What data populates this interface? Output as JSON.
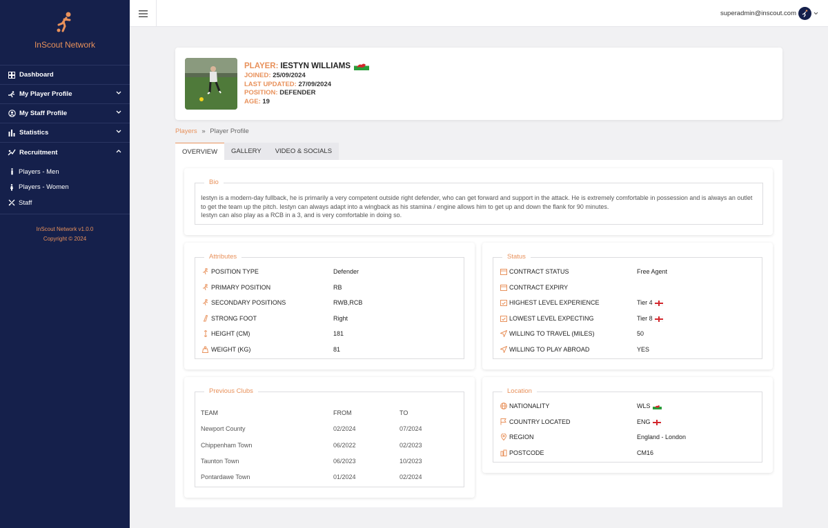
{
  "app": {
    "name": "InScout Network",
    "version": "InScout Network v1.0.0",
    "copyright": "Copyright © 2024"
  },
  "topbar": {
    "user_email": "superadmin@inscout.com"
  },
  "sidebar": {
    "items": [
      {
        "label": "Dashboard",
        "icon": "dashboard-icon"
      },
      {
        "label": "My Player Profile",
        "icon": "runner-icon"
      },
      {
        "label": "My Staff Profile",
        "icon": "user-circle-icon"
      },
      {
        "label": "Statistics",
        "icon": "bar-chart-icon"
      },
      {
        "label": "Recruitment",
        "icon": "recruitment-icon"
      }
    ],
    "sub_items": [
      {
        "label": "Players - Men"
      },
      {
        "label": "Players - Women"
      },
      {
        "label": "Staff"
      }
    ]
  },
  "player": {
    "player_label": "PLAYER:",
    "name": "IESTYN WILLIAMS",
    "joined_label": "JOINED:",
    "joined": "25/09/2024",
    "updated_label": "LAST UPDATED:",
    "updated": "27/09/2024",
    "position_label": "POSITION:",
    "position": "DEFENDER",
    "age_label": "AGE:",
    "age": "19"
  },
  "breadcrumb": {
    "link": "Players",
    "separator": "»",
    "current": "Player Profile"
  },
  "tabs": [
    "OVERVIEW",
    "GALLERY",
    "VIDEO & SOCIALS"
  ],
  "bio": {
    "title": "Bio",
    "text": "Iestyn is a modern-day fullback, he is primarily a very competent outside right defender, who can get forward and support in the attack. He is extremely comfortable in possession and is always an outlet to get the team up the pitch. Iestyn can always adapt into a wingback as his stamina / engine allows him to get up and down the flank for 90 minutes.",
    "text2": "Iestyn can also play as a RCB in a 3, and is very comfortable in doing so."
  },
  "attributes": {
    "title": "Attributes",
    "rows": [
      {
        "label": "POSITION TYPE",
        "value": "Defender"
      },
      {
        "label": "PRIMARY POSITION",
        "value": "RB"
      },
      {
        "label": "SECONDARY POSITIONS",
        "value": "RWB,RCB"
      },
      {
        "label": "STRONG FOOT",
        "value": "Right"
      },
      {
        "label": "HEIGHT (CM)",
        "value": "181"
      },
      {
        "label": "WEIGHT (KG)",
        "value": "81"
      }
    ]
  },
  "status": {
    "title": "Status",
    "rows": [
      {
        "label": "CONTRACT STATUS",
        "value": "Free Agent"
      },
      {
        "label": "CONTRACT EXPIRY",
        "value": ""
      },
      {
        "label": "HIGHEST LEVEL EXPERIENCE",
        "value": "Tier 4"
      },
      {
        "label": "LOWEST LEVEL EXPECTING",
        "value": "Tier 8"
      },
      {
        "label": "WILLING TO TRAVEL (MILES)",
        "value": "50"
      },
      {
        "label": "WILLING TO PLAY ABROAD",
        "value": "YES"
      }
    ]
  },
  "clubs": {
    "title": "Previous Clubs",
    "headers": {
      "team": "TEAM",
      "from": "FROM",
      "to": "TO"
    },
    "rows": [
      {
        "team": "Newport County",
        "from": "02/2024",
        "to": "07/2024"
      },
      {
        "team": "Chippenham Town",
        "from": "06/2022",
        "to": "02/2023"
      },
      {
        "team": "Taunton Town",
        "from": "06/2023",
        "to": "10/2023"
      },
      {
        "team": "Pontardawe Town",
        "from": "01/2024",
        "to": "02/2024"
      }
    ]
  },
  "location": {
    "title": "Location",
    "rows": [
      {
        "label": "NATIONALITY",
        "value": "WLS"
      },
      {
        "label": "COUNTRY LOCATED",
        "value": "ENG"
      },
      {
        "label": "REGION",
        "value": "England - London"
      },
      {
        "label": "POSTCODE",
        "value": "CM16"
      }
    ]
  },
  "colors": {
    "accent": "#e8915b",
    "sidebar": "#15204b"
  }
}
